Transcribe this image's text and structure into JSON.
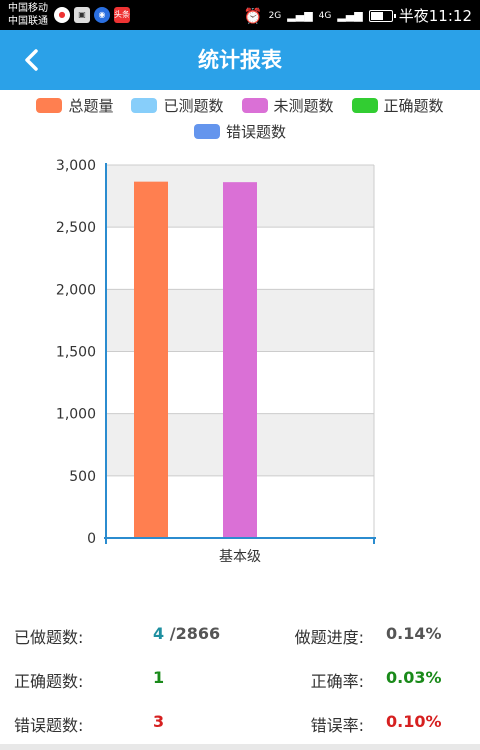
{
  "status_bar": {
    "carrier1": "中国移动",
    "carrier2": "中国联通",
    "net1": "2G",
    "net2": "4G",
    "time": "半夜11:12",
    "app_icons": [
      "weibo-icon",
      "image-icon",
      "qq-icon",
      "toutiao-icon"
    ],
    "toutiao_label": "头条"
  },
  "header": {
    "title": "统计报表",
    "bg_color": "#2ba1e8"
  },
  "legend": [
    {
      "label": "总题量",
      "color": "#ff7f50"
    },
    {
      "label": "已测题数",
      "color": "#87cefa"
    },
    {
      "label": "未测题数",
      "color": "#da70d6"
    },
    {
      "label": "正确题数",
      "color": "#32cd32"
    },
    {
      "label": "错误题数",
      "color": "#6495ed"
    }
  ],
  "chart_data": {
    "type": "bar",
    "categories": [
      "基本级"
    ],
    "series": [
      {
        "name": "总题量",
        "values": [
          2866
        ],
        "color": "#ff7f50"
      },
      {
        "name": "已测题数",
        "values": [
          4
        ],
        "color": "#87cefa"
      },
      {
        "name": "未测题数",
        "values": [
          2862
        ],
        "color": "#da70d6"
      },
      {
        "name": "正确题数",
        "values": [
          1
        ],
        "color": "#32cd32"
      },
      {
        "name": "错误题数",
        "values": [
          3
        ],
        "color": "#6495ed"
      }
    ],
    "ylim": [
      0,
      3000
    ],
    "yticks": [
      "0",
      "500",
      "1,000",
      "1,500",
      "2,000",
      "2,500",
      "3,000"
    ],
    "grid": true,
    "legend_position": "top"
  },
  "stats": {
    "done_label": "已做题数:",
    "done_value": "4",
    "total_value": "/2866",
    "progress_label": "做题进度:",
    "progress_value": "0.14%",
    "correct_label": "正确题数:",
    "correct_value": "1",
    "correct_rate_label": "正确率:",
    "correct_rate_value": "0.03%",
    "wrong_label": "错误题数:",
    "wrong_value": "3",
    "wrong_rate_label": "错误率:",
    "wrong_rate_value": "0.10%",
    "colors": {
      "done": "#1e8fa0",
      "neutral": "#555555",
      "correct": "#1a8a1a",
      "wrong": "#d62020"
    }
  }
}
